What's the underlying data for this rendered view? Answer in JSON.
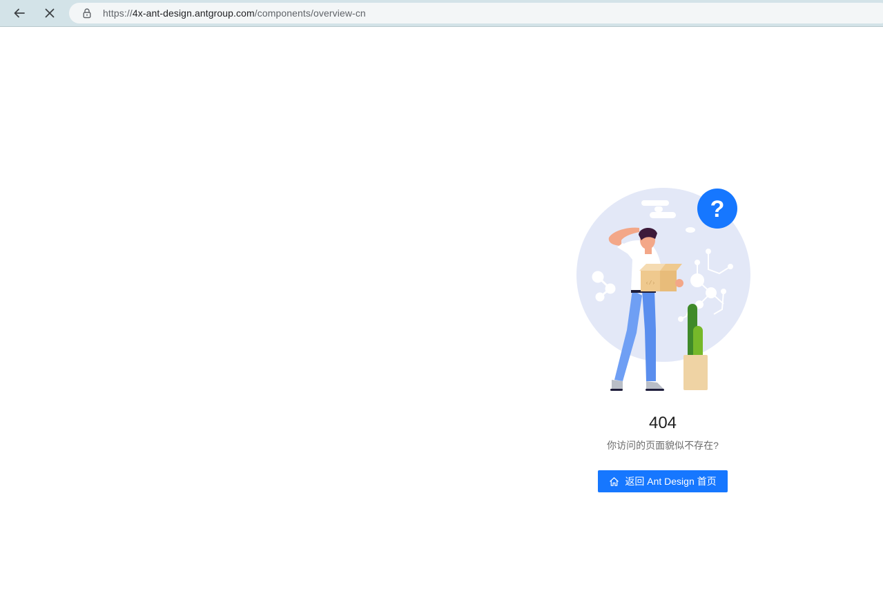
{
  "browser": {
    "url_scheme": "https://",
    "url_host": "4x-ant-design.antgroup.com",
    "url_path": "/components/overview-cn",
    "icons": {
      "back": "back-arrow-icon",
      "stop": "close-icon",
      "lock": "lock-icon"
    }
  },
  "result": {
    "status": "404",
    "subtitle": "你访问的页面貌似不存在?",
    "button_label": "返回 Ant Design 首页",
    "button_icon": "home-icon",
    "question_mark": "?"
  },
  "colors": {
    "primary": "#1677ff",
    "browser_chrome": "#d3e3e8",
    "circle_bg": "#e3e8f7",
    "question_badge": "#1677ff"
  }
}
